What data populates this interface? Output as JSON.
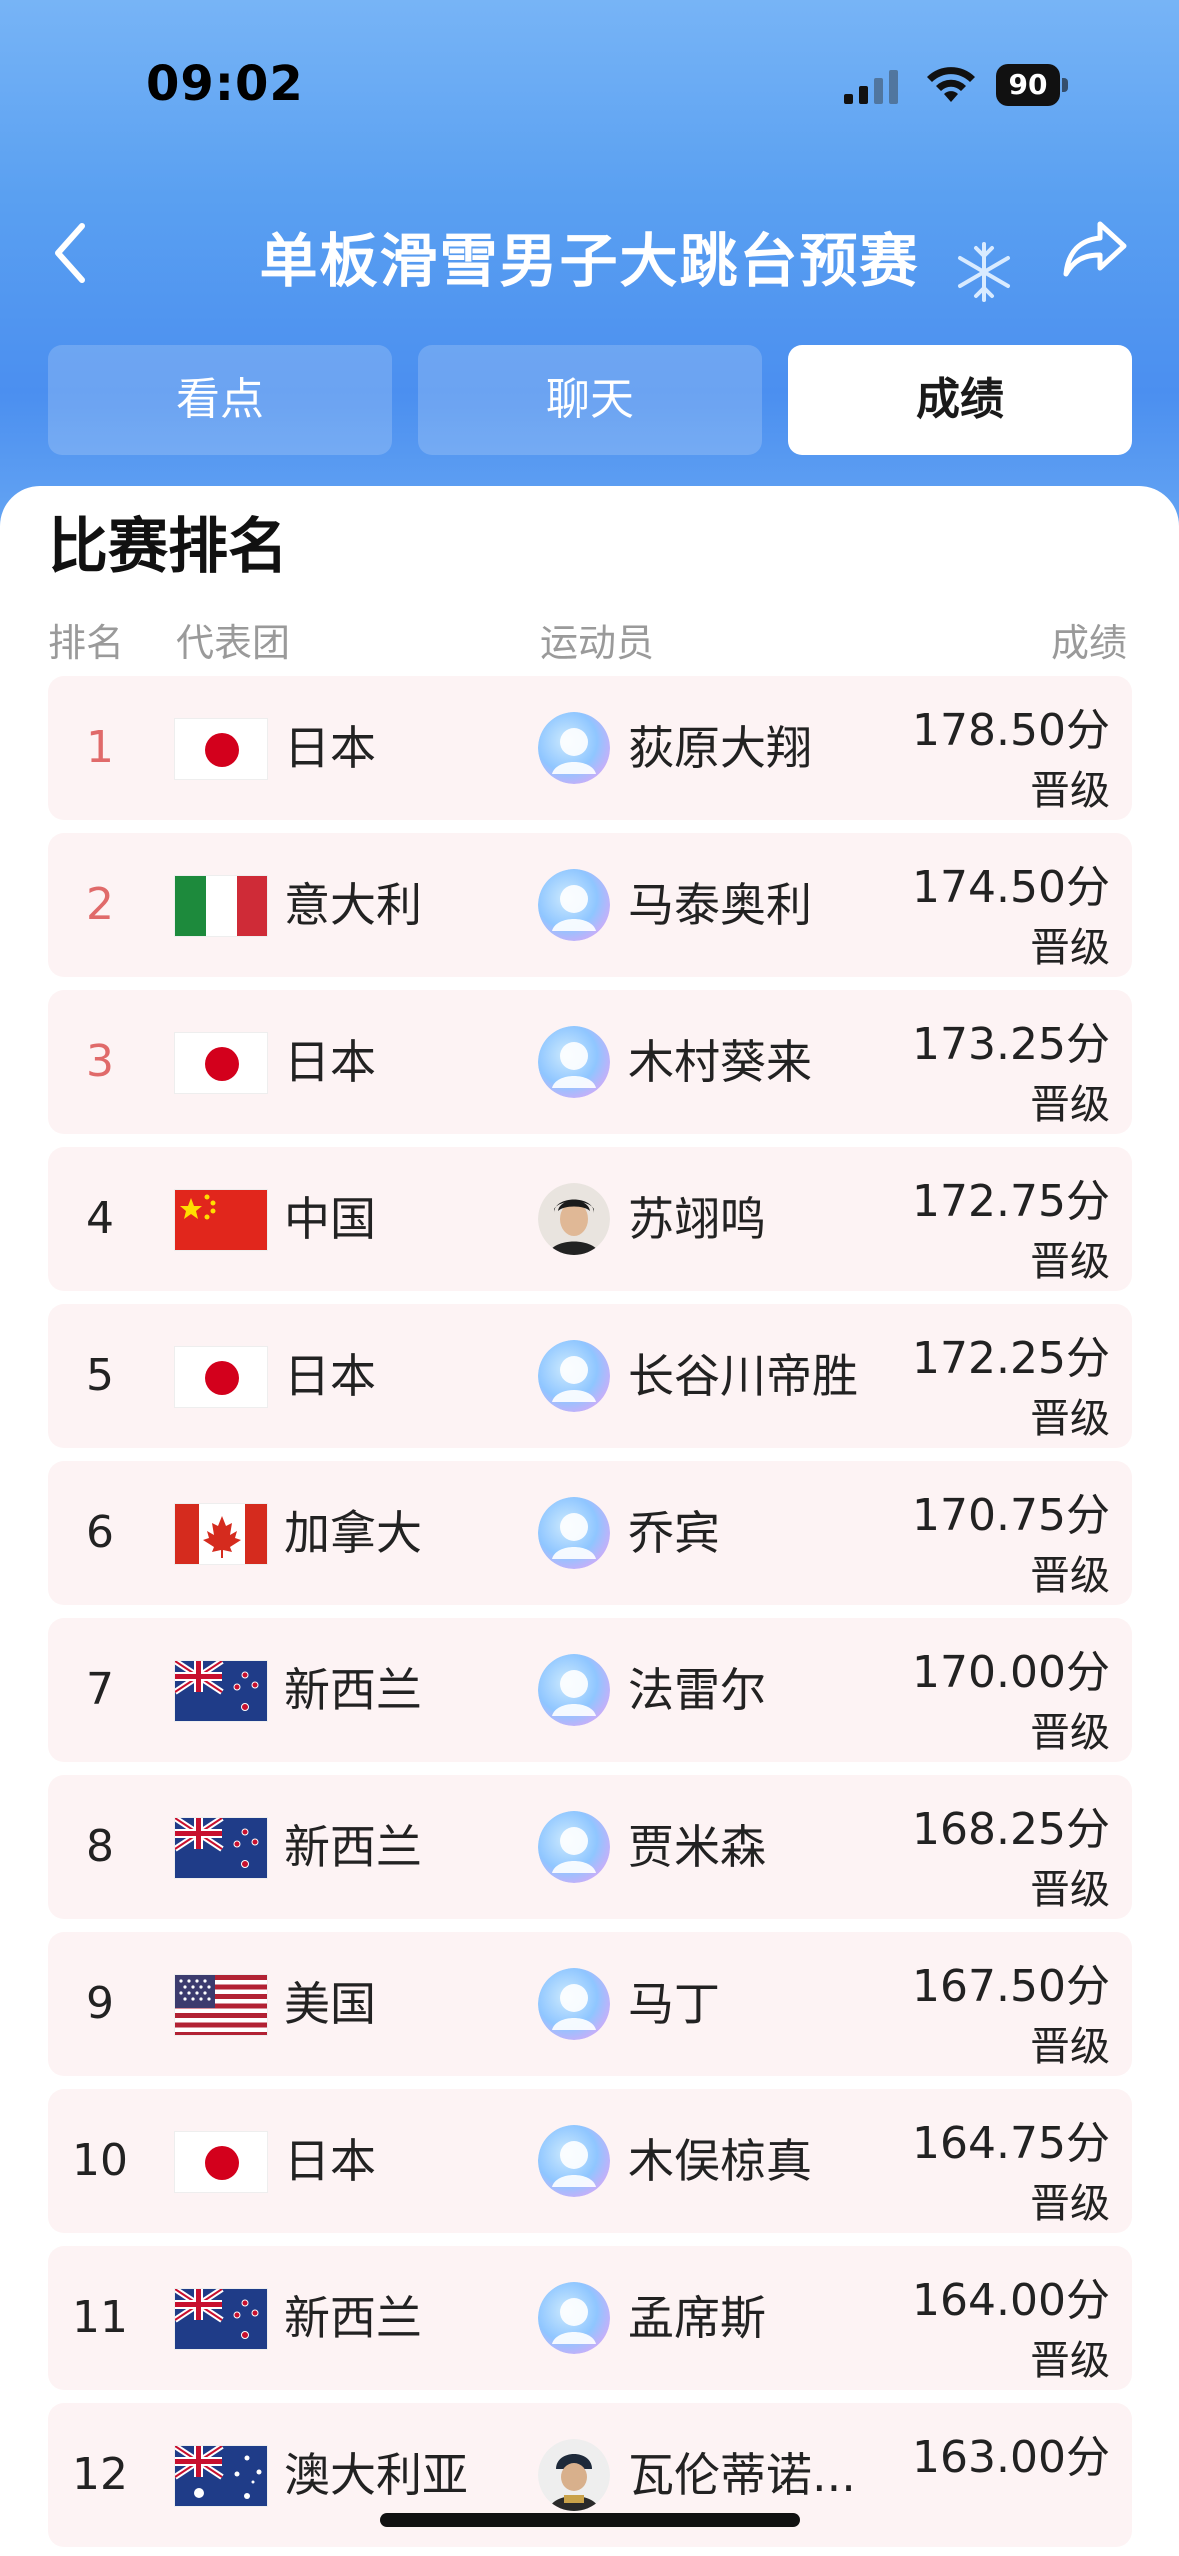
{
  "status_bar": {
    "time": "09:02",
    "battery": "90"
  },
  "header": {
    "title": "单板滑雪男子大跳台预赛"
  },
  "tabs": [
    {
      "label": "看点"
    },
    {
      "label": "聊天"
    },
    {
      "label": "成绩"
    }
  ],
  "section": {
    "title": "比赛排名",
    "columns": {
      "rank": "排名",
      "team": "代表团",
      "athlete": "运动员",
      "score": "成绩"
    }
  },
  "rows": [
    {
      "rank": "1",
      "country": "日本",
      "flag": "japan",
      "athlete": "荻原大翔",
      "score": "178.50分",
      "status": "晋级"
    },
    {
      "rank": "2",
      "country": "意大利",
      "flag": "italy",
      "athlete": "马泰奥利",
      "score": "174.50分",
      "status": "晋级"
    },
    {
      "rank": "3",
      "country": "日本",
      "flag": "japan",
      "athlete": "木村葵来",
      "score": "173.25分",
      "status": "晋级"
    },
    {
      "rank": "4",
      "country": "中国",
      "flag": "china",
      "athlete": "苏翊鸣",
      "score": "172.75分",
      "status": "晋级"
    },
    {
      "rank": "5",
      "country": "日本",
      "flag": "japan",
      "athlete": "长谷川帝胜",
      "score": "172.25分",
      "status": "晋级"
    },
    {
      "rank": "6",
      "country": "加拿大",
      "flag": "canada",
      "athlete": "乔宾",
      "score": "170.75分",
      "status": "晋级"
    },
    {
      "rank": "7",
      "country": "新西兰",
      "flag": "new-zealand",
      "athlete": "法雷尔",
      "score": "170.00分",
      "status": "晋级"
    },
    {
      "rank": "8",
      "country": "新西兰",
      "flag": "new-zealand",
      "athlete": "贾米森",
      "score": "168.25分",
      "status": "晋级"
    },
    {
      "rank": "9",
      "country": "美国",
      "flag": "usa",
      "athlete": "马丁",
      "score": "167.50分",
      "status": "晋级"
    },
    {
      "rank": "10",
      "country": "日本",
      "flag": "japan",
      "athlete": "木俣椋真",
      "score": "164.75分",
      "status": "晋级"
    },
    {
      "rank": "11",
      "country": "新西兰",
      "flag": "new-zealand",
      "athlete": "孟席斯",
      "score": "164.00分",
      "status": "晋级"
    },
    {
      "rank": "12",
      "country": "澳大利亚",
      "flag": "australia",
      "athlete": "瓦伦蒂诺...",
      "score": "163.00分",
      "status": ""
    }
  ],
  "colors": {
    "accent_blue": "#4b8ff0",
    "row_bg": "#fdf3f4",
    "top3_rank": "#e06a6a"
  }
}
